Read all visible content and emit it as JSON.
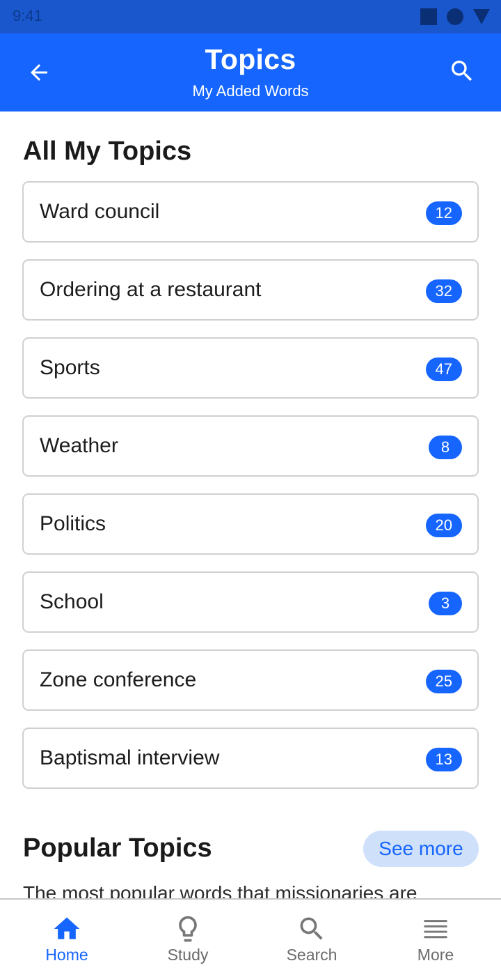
{
  "status_bar": {
    "time": "9:41"
  },
  "app_bar": {
    "title": "Topics",
    "subtitle": "My Added Words",
    "back_icon": "arrow-left-icon",
    "search_icon": "search-icon"
  },
  "all_topics": {
    "title": "All My Topics",
    "items": [
      {
        "label": "Ward council",
        "count": "12"
      },
      {
        "label": "Ordering at a restaurant",
        "count": "32"
      },
      {
        "label": "Sports",
        "count": "47"
      },
      {
        "label": "Weather",
        "count": "8"
      },
      {
        "label": "Politics",
        "count": "20"
      },
      {
        "label": "School",
        "count": "3"
      },
      {
        "label": "Zone conference",
        "count": "25"
      },
      {
        "label": "Baptismal interview",
        "count": "13"
      }
    ]
  },
  "popular": {
    "title": "Popular Topics",
    "see_more": "See more",
    "description": "The most popular words that missionaries are"
  },
  "bottom_nav": {
    "items": [
      {
        "label": "Home",
        "icon": "home-icon",
        "active": true
      },
      {
        "label": "Study",
        "icon": "lightbulb-icon",
        "active": false
      },
      {
        "label": "Search",
        "icon": "search-icon",
        "active": false
      },
      {
        "label": "More",
        "icon": "menu-icon",
        "active": false
      }
    ]
  },
  "colors": {
    "primary": "#1565fe",
    "status_bar": "#1b57cc",
    "see_more_bg": "#cfe0fb",
    "inactive_nav": "#6b6b6b"
  }
}
